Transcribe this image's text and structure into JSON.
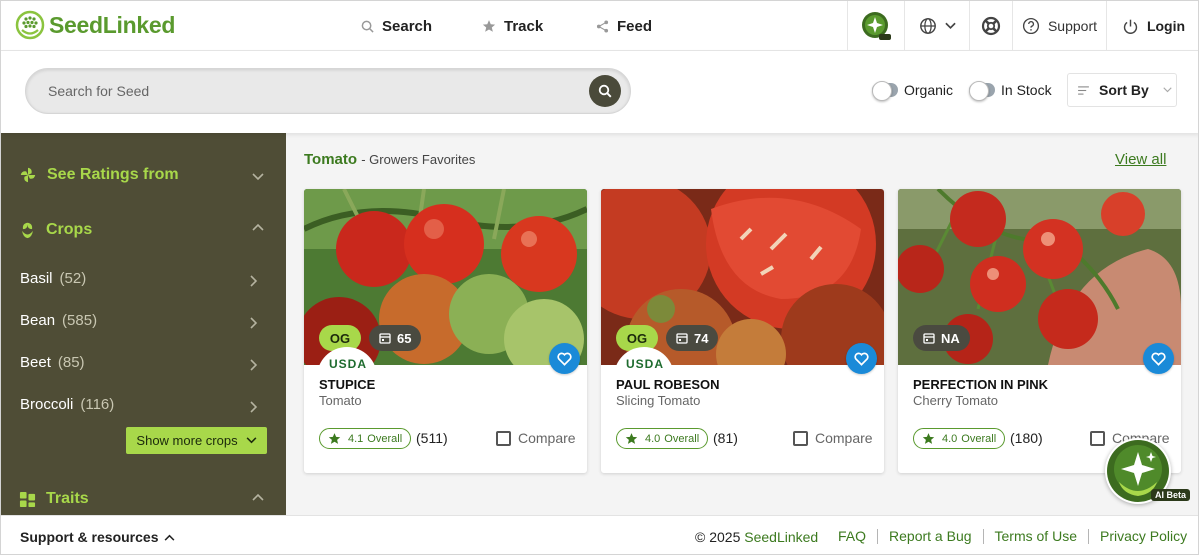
{
  "header": {
    "logo_text": "SeedLinked",
    "nav": [
      {
        "label": "Search",
        "icon": "search-icon"
      },
      {
        "label": "Track",
        "icon": "star-icon"
      },
      {
        "label": "Feed",
        "icon": "share-icon"
      }
    ],
    "support_label": "Support",
    "login_label": "Login"
  },
  "search": {
    "placeholder": "Search for Seed",
    "value": ""
  },
  "filters": {
    "organic_label": "Organic",
    "organic_on": false,
    "instock_label": "In Stock",
    "instock_on": false,
    "sort_label": "Sort By"
  },
  "sidebar": {
    "ratings_label": "See Ratings from",
    "crops_label": "Crops",
    "crops": [
      {
        "name": "Basil",
        "count": "(52)"
      },
      {
        "name": "Bean",
        "count": "(585)"
      },
      {
        "name": "Beet",
        "count": "(85)"
      },
      {
        "name": "Broccoli",
        "count": "(116)"
      }
    ],
    "more_label": "Show more crops",
    "traits_label": "Traits"
  },
  "main": {
    "crop_title": "Tomato",
    "subtitle": "- Growers Favorites",
    "view_all": "View all",
    "cards": [
      {
        "name": "STUPICE",
        "type": "Tomato",
        "organic": "OG",
        "days": "65",
        "usda": "USDA",
        "rating": "4.1",
        "rating_label": "Overall",
        "count": "(511)",
        "compare": "Compare"
      },
      {
        "name": "PAUL ROBESON",
        "type": "Slicing Tomato",
        "organic": "OG",
        "days": "74",
        "usda": "USDA",
        "rating": "4.0",
        "rating_label": "Overall",
        "count": "(81)",
        "compare": "Compare"
      },
      {
        "name": "PERFECTION IN PINK",
        "type": "Cherry Tomato",
        "organic": "",
        "days": "NA",
        "usda": "",
        "rating": "4.0",
        "rating_label": "Overall",
        "count": "(180)",
        "compare": "Compare"
      }
    ]
  },
  "ai": {
    "label": "AI Beta"
  },
  "footer": {
    "support_label": "Support & resources",
    "copyright_prefix": "© 2025",
    "copyright_brand": "SeedLinked",
    "links": [
      "FAQ",
      "Report a Bug",
      "Terms of Use",
      "Privacy Policy"
    ]
  },
  "colors": {
    "brand_green": "#5a9a2e",
    "accent_lime": "#a8d84a",
    "sidebar_bg": "#4f4d36",
    "accent_blue": "#1a8ad8"
  }
}
